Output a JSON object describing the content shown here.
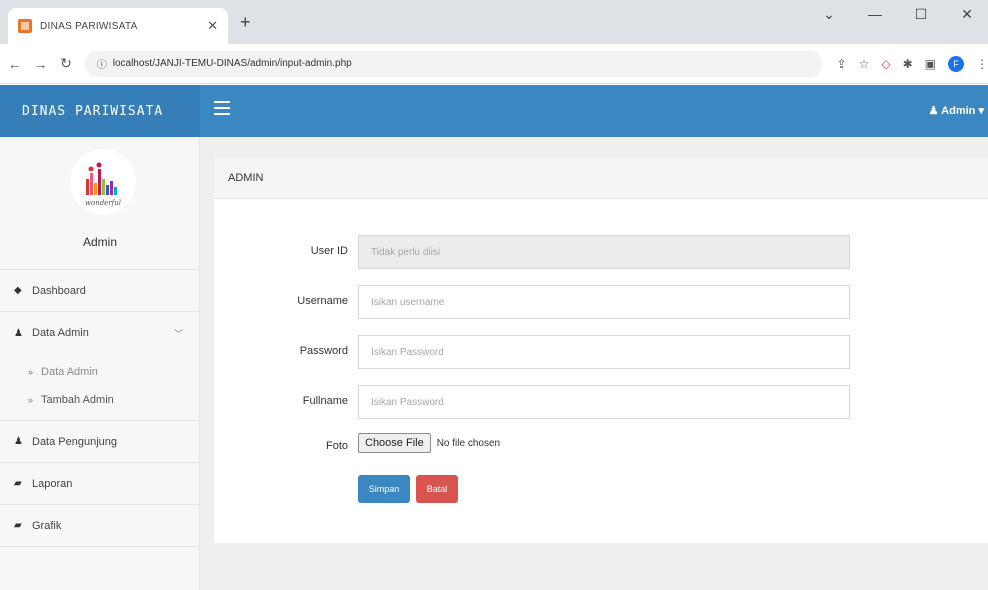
{
  "browser": {
    "tab_title": "DINAS PARIWISATA",
    "url": "localhost/JANJI-TEMU-DINAS/admin/input-admin.php",
    "profile_initial": "F"
  },
  "header": {
    "brand": "DINAS PARIWISATA",
    "user_menu": "Admin"
  },
  "sidebar": {
    "logo_text": "wonderful",
    "user_name": "Admin",
    "items": [
      {
        "label": "Dashboard",
        "icon": "dashboard-icon"
      },
      {
        "label": "Data Admin",
        "icon": "user-icon",
        "expanded": true
      },
      {
        "label": "Data Pengunjung",
        "icon": "user-icon"
      },
      {
        "label": "Laporan",
        "icon": "file-icon"
      },
      {
        "label": "Grafik",
        "icon": "file-icon"
      }
    ],
    "subitems": [
      {
        "label": "Data Admin"
      },
      {
        "label": "Tambah Admin"
      }
    ]
  },
  "panel": {
    "title": "ADMIN"
  },
  "form": {
    "user_id": {
      "label": "User ID",
      "placeholder": "Tidak perlu diisi"
    },
    "username": {
      "label": "Username",
      "placeholder": "Isikan username"
    },
    "password": {
      "label": "Password",
      "placeholder": "Isikan Password"
    },
    "fullname": {
      "label": "Fullname",
      "placeholder": "Isikan Password"
    },
    "foto": {
      "label": "Foto",
      "button": "Choose File",
      "status": "No file chosen"
    },
    "save_label": "Simpan",
    "cancel_label": "Batal"
  },
  "colors": {
    "header_blue": "#3a87c2",
    "save_blue": "#3a87c2",
    "cancel_red": "#d9534f"
  }
}
